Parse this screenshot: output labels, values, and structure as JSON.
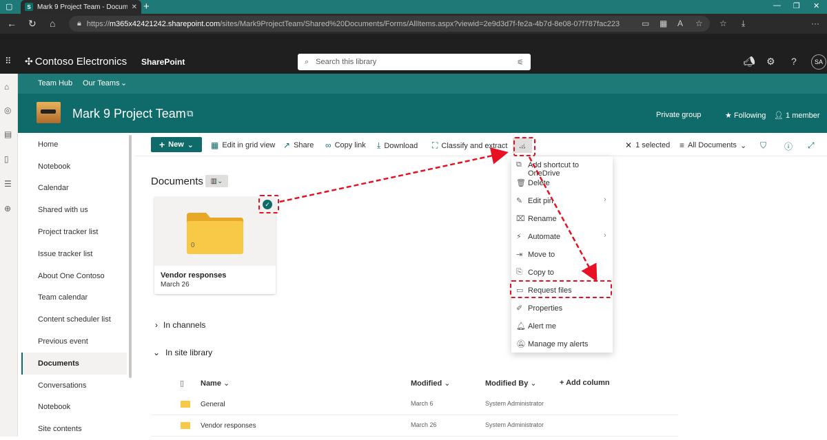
{
  "browser": {
    "tab_title": "Mark 9 Project Team - Documen",
    "url_prefix": "https://",
    "url_host": "m365x42421242.sharepoint.com",
    "url_path": "/sites/Mark9ProjectTeam/Shared%20Documents/Forms/AllItems.aspx?viewid=2e9d3d7f-fe2a-4b7d-8e08-07f787fac223"
  },
  "suite": {
    "brand": "Contoso Electronics",
    "app": "SharePoint",
    "search_placeholder": "Search this library",
    "avatar": "SA"
  },
  "hub": {
    "team_hub": "Team Hub",
    "our_teams": "Our Teams"
  },
  "site": {
    "title": "Mark 9 Project Team",
    "private_group": "Private group",
    "following": "Following",
    "members": "1 member"
  },
  "leftnav": [
    {
      "label": "Home"
    },
    {
      "label": "Notebook"
    },
    {
      "label": "Calendar"
    },
    {
      "label": "Shared with us"
    },
    {
      "label": "Project tracker list"
    },
    {
      "label": "Issue tracker list"
    },
    {
      "label": "About One Contoso"
    },
    {
      "label": "Team calendar"
    },
    {
      "label": "Content scheduler list"
    },
    {
      "label": "Previous event"
    },
    {
      "label": "Documents"
    },
    {
      "label": "Conversations"
    },
    {
      "label": "Notebook"
    },
    {
      "label": "Site contents"
    }
  ],
  "commands": {
    "new": "New",
    "edit_grid": "Edit in grid view",
    "share": "Share",
    "copy_link": "Copy link",
    "download": "Download",
    "classify": "Classify and extract",
    "more": "...",
    "selected": "1 selected",
    "view": "All Documents"
  },
  "library": {
    "title": "Documents",
    "pinned": {
      "name": "Vendor responses",
      "date": "March 26",
      "count": "0"
    },
    "in_channels": "In channels",
    "in_site_library": "In site library"
  },
  "table": {
    "headers": {
      "name": "Name",
      "modified": "Modified",
      "modified_by": "Modified By",
      "add_column": "+ Add column"
    },
    "rows": [
      {
        "name": "General",
        "modified": "March 6",
        "modified_by": "System Administrator"
      },
      {
        "name": "Vendor responses",
        "modified": "March 26",
        "modified_by": "System Administrator"
      }
    ]
  },
  "context_menu": [
    {
      "label": "Add shortcut to OneDrive",
      "icon": "shortcut-icon"
    },
    {
      "label": "Delete",
      "icon": "trash-icon"
    },
    {
      "label": "Edit pin",
      "icon": "pin-icon",
      "submenu": true
    },
    {
      "label": "Rename",
      "icon": "rename-icon"
    },
    {
      "label": "Automate",
      "icon": "automate-icon",
      "submenu": true
    },
    {
      "label": "Move to",
      "icon": "move-icon"
    },
    {
      "label": "Copy to",
      "icon": "copy-icon"
    },
    {
      "label": "Request files",
      "icon": "request-files-icon"
    },
    {
      "label": "Properties",
      "icon": "pencil-icon"
    },
    {
      "label": "Alert me",
      "icon": "bell-icon"
    },
    {
      "label": "Manage my alerts",
      "icon": "manage-alerts-icon"
    }
  ],
  "colors": {
    "brand": "#0f6b69",
    "hub": "#1e7a77",
    "annotation": "#e81123",
    "folder": "#f8c847"
  }
}
